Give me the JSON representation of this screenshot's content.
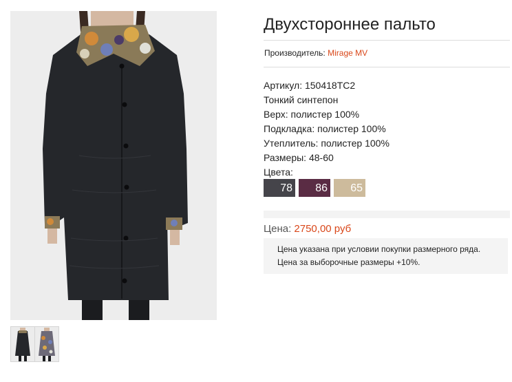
{
  "product": {
    "title": "Двухстороннее пальто",
    "maker_label": "Производитель:",
    "maker_name": "Mirage MV",
    "specs": [
      "Артикул: 150418TC2",
      "Тонкий синтепон",
      "Верх: полистер 100%",
      "Подкладка: полистер 100%",
      "Утеплитель: полистер 100%",
      "Размеры: 48-60"
    ],
    "colors_label": "Цвета:",
    "colors": [
      {
        "code": "78",
        "hex": "#45444a"
      },
      {
        "code": "86",
        "hex": "#5a2c44"
      },
      {
        "code": "65",
        "hex": "#cdbb9c"
      }
    ],
    "price_label": "Цена:",
    "price_value": "2750,00 руб",
    "notes": [
      "Цена указана при условии покупки размерного ряда.",
      "Цена за выборочные размеры +10%."
    ]
  },
  "theme": {
    "accent": "#d9471a",
    "coat_color": "#25272b",
    "photo_bg": "#ededed"
  }
}
